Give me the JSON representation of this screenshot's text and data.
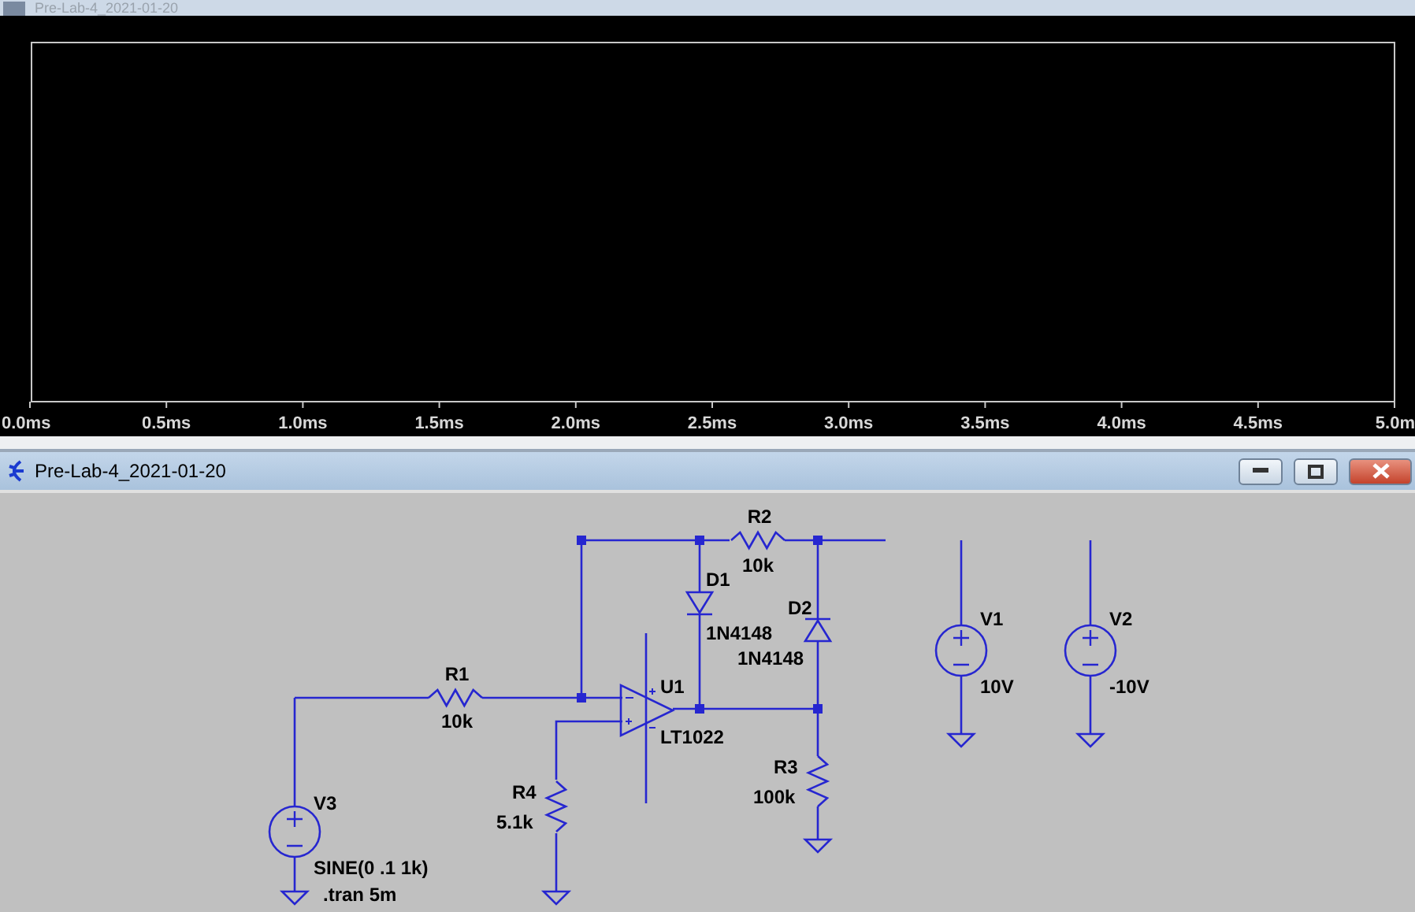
{
  "plot_window": {
    "title": "Pre-Lab-4_2021-01-20",
    "x_axis_labels": [
      "0.0ms",
      "0.5ms",
      "1.0ms",
      "1.5ms",
      "2.0ms",
      "2.5ms",
      "3.0ms",
      "3.5ms",
      "4.0ms",
      "4.5ms",
      "5.0m"
    ]
  },
  "schematic_window": {
    "title": "Pre-Lab-4_2021-01-20",
    "components": [
      {
        "kind": "voltage_source",
        "ref": "V3",
        "value": "SINE(0 .1 1k)"
      },
      {
        "kind": "resistor",
        "ref": "R1",
        "value": "10k"
      },
      {
        "kind": "opamp",
        "ref": "U1",
        "value": "LT1022"
      },
      {
        "kind": "resistor",
        "ref": "R2",
        "value": "10k"
      },
      {
        "kind": "diode",
        "ref": "D1",
        "value": "1N4148"
      },
      {
        "kind": "diode",
        "ref": "D2",
        "value": "1N4148"
      },
      {
        "kind": "resistor",
        "ref": "R3",
        "value": "100k"
      },
      {
        "kind": "resistor",
        "ref": "R4",
        "value": "5.1k"
      },
      {
        "kind": "voltage_source",
        "ref": "V1",
        "value": "10V"
      },
      {
        "kind": "voltage_source",
        "ref": "V2",
        "value": "-10V"
      }
    ],
    "directive": ".tran 5m"
  }
}
